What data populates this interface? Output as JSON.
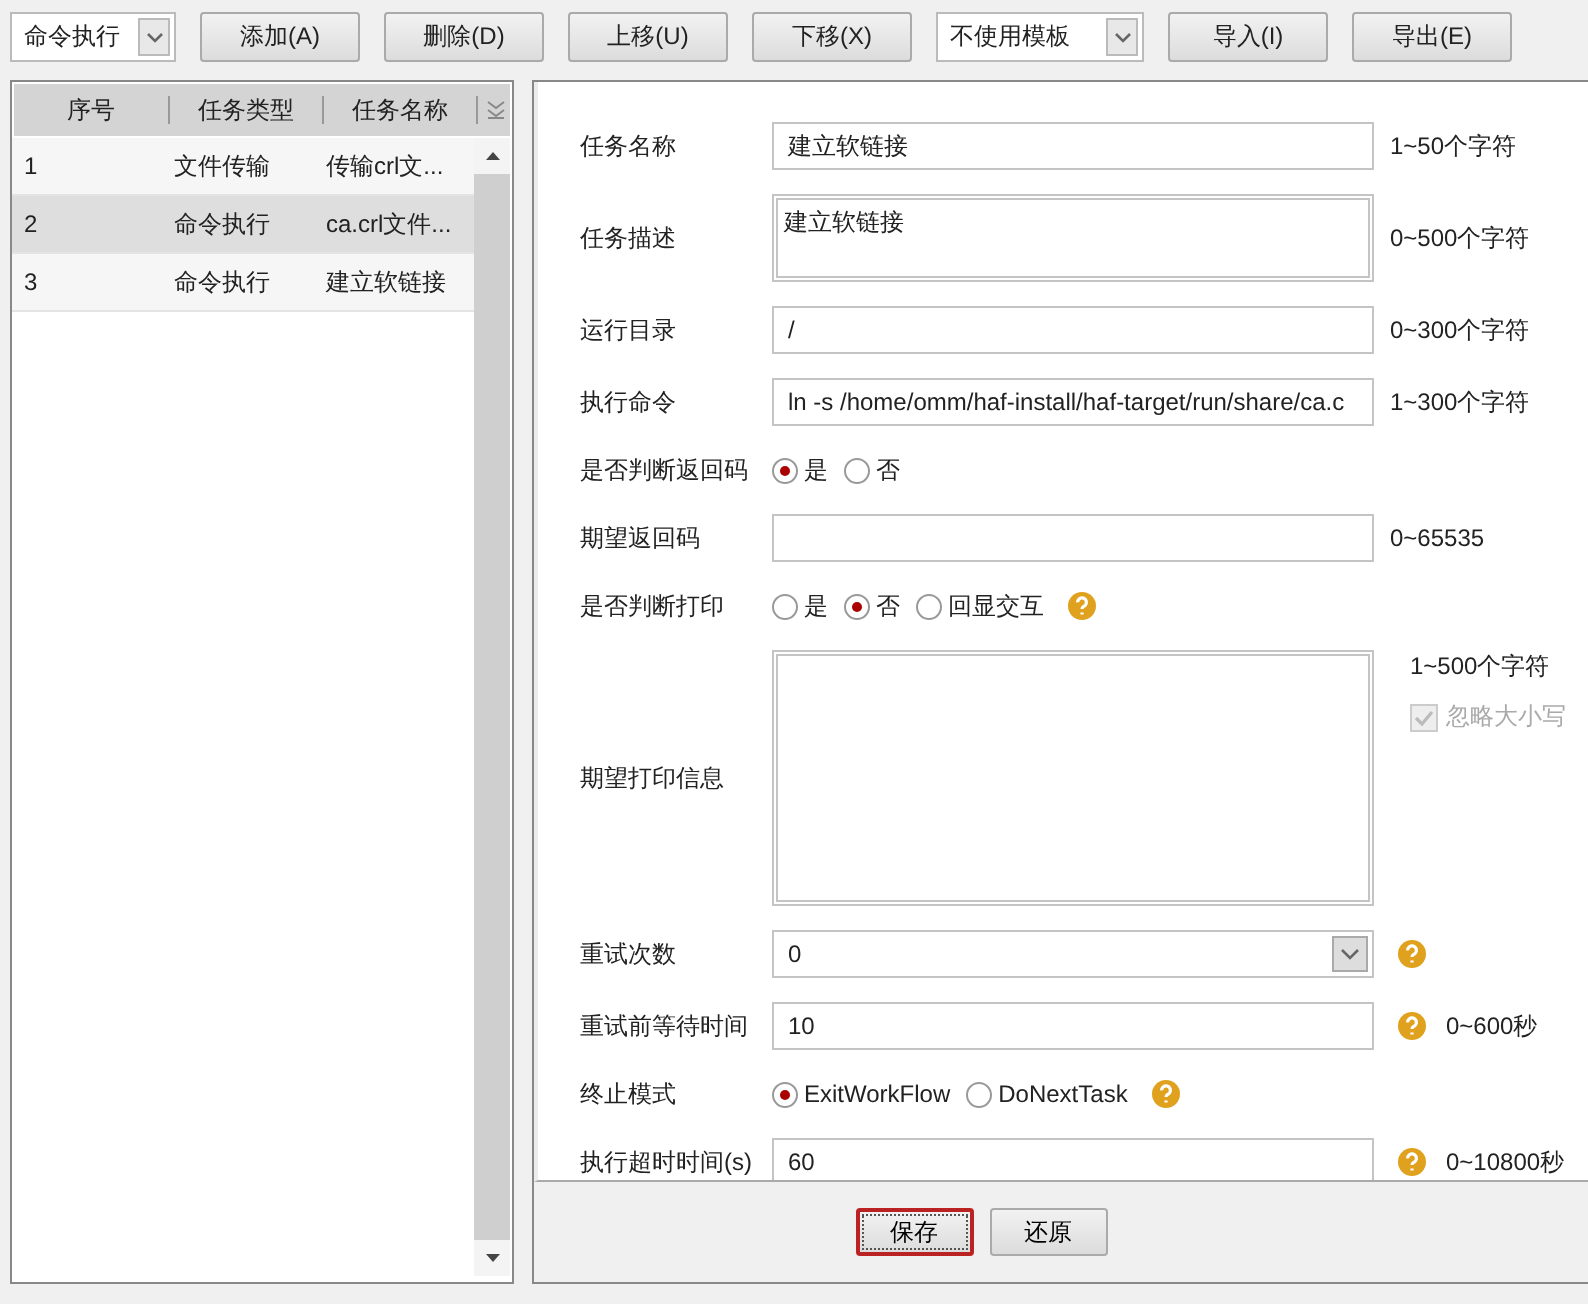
{
  "toolbar": [
    {
      "kind": "select",
      "value": "命令执行"
    },
    {
      "kind": "button",
      "label": "添加(A)"
    },
    {
      "kind": "button",
      "label": "删除(D)"
    },
    {
      "kind": "button",
      "label": "上移(U)"
    },
    {
      "kind": "button",
      "label": "下移(X)"
    },
    {
      "kind": "select",
      "value": "不使用模板"
    },
    {
      "kind": "button",
      "label": "导入(I)"
    },
    {
      "kind": "button",
      "label": "导出(E)"
    }
  ],
  "table": {
    "columns": [
      "序号",
      "任务类型",
      "任务名称"
    ],
    "rows": [
      {
        "cells": [
          "1",
          "文件传输",
          "传输crl文..."
        ],
        "selected": false
      },
      {
        "cells": [
          "2",
          "命令执行",
          "ca.crl文件..."
        ],
        "selected": true
      },
      {
        "cells": [
          "3",
          "命令执行",
          "建立软链接"
        ],
        "selected": false
      }
    ]
  },
  "form": [
    {
      "kind": "text",
      "label": "任务名称",
      "value": "建立软链接",
      "hint": "1~50个字符"
    },
    {
      "kind": "textarea",
      "label": "任务描述",
      "value": "建立软链接",
      "hint": "0~500个字符"
    },
    {
      "kind": "text",
      "label": "运行目录",
      "value": "/",
      "hint": "0~300个字符"
    },
    {
      "kind": "text",
      "label": "执行命令",
      "value": "ln -s  /home/omm/haf-install/haf-target/run/share/ca.c",
      "hint": "1~300个字符"
    },
    {
      "kind": "radio",
      "label": "是否判断返回码",
      "options": [
        {
          "label": "是",
          "selected": true
        },
        {
          "label": "否",
          "selected": false
        }
      ]
    },
    {
      "kind": "text",
      "label": "期望返回码",
      "hint": "0~65535"
    },
    {
      "kind": "radio",
      "label": "是否判断打印",
      "options": [
        {
          "label": "是",
          "selected": false
        },
        {
          "label": "否",
          "selected": true
        },
        {
          "label": "回显交互",
          "selected": false
        }
      ],
      "help": true
    },
    {
      "kind": "bigtext",
      "label": "期望打印信息",
      "hint": "1~500个字符",
      "checkbox": {
        "label": "忽略大小写",
        "checked": true,
        "disabled": true
      }
    },
    {
      "kind": "select",
      "label": "重试次数",
      "value": "0",
      "help": true
    },
    {
      "kind": "text",
      "label": "重试前等待时间",
      "value": "10",
      "help": true,
      "hint": "0~600秒"
    },
    {
      "kind": "radio",
      "label": "终止模式",
      "options": [
        {
          "label": "ExitWorkFlow",
          "selected": true
        },
        {
          "label": "DoNextTask",
          "selected": false
        }
      ],
      "help": true
    },
    {
      "kind": "text",
      "label": "执行超时时间(s)",
      "value": "60",
      "help": true,
      "hint": "0~10800秒"
    }
  ],
  "footer": [
    {
      "label": "保存",
      "focused": true
    },
    {
      "label": "还原",
      "focused": false
    }
  ]
}
